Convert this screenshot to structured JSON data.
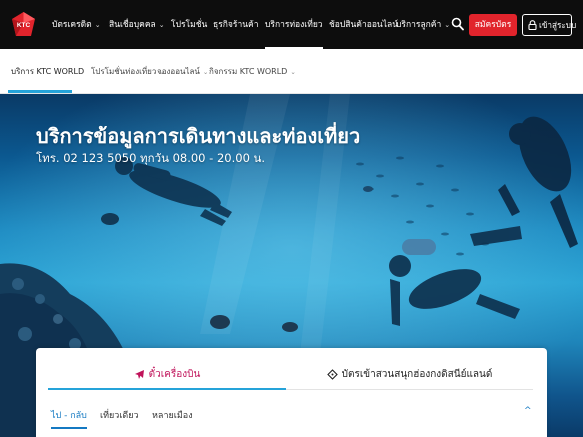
{
  "header": {
    "logo_text": "KTC",
    "nav": [
      {
        "label": "บัตรเครดิต",
        "has_dropdown": true
      },
      {
        "label": "สินเชื่อบุคคล",
        "has_dropdown": true
      },
      {
        "label": "โปรโมชั่น",
        "has_dropdown": false
      },
      {
        "label": "ธุรกิจร้านค้า",
        "has_dropdown": false
      },
      {
        "label": "บริการท่องเที่ยว",
        "has_dropdown": false,
        "active": true
      },
      {
        "label": "ช้อปสินค้าออนไลน์",
        "has_dropdown": false
      },
      {
        "label": "บริการลูกค้า",
        "has_dropdown": true
      }
    ],
    "apply_label": "สมัครบัตร",
    "login_label": "เข้าสู่ระบบ",
    "icons": [
      "search-icon",
      "lock-icon"
    ],
    "colors": {
      "bar": "#0d0d0d",
      "apply": "#e1242c"
    }
  },
  "subnav": {
    "items": [
      {
        "label": "บริการ KTC WORLD",
        "has_dropdown": false,
        "active": true
      },
      {
        "label": "โปรโมชั่นท่องเที่ยว",
        "has_dropdown": true
      },
      {
        "label": "จองออนไลน์",
        "has_dropdown": true
      },
      {
        "label": "กิจกรรม KTC WORLD",
        "has_dropdown": true
      }
    ],
    "accent": "#25a3d9"
  },
  "hero": {
    "title": "บริการข้อมูลการเดินทางและท่องเที่ยว",
    "subtitle": "โทร. 02 123 5050 ทุกวัน 08.00 - 20.00 น."
  },
  "booking": {
    "tabs": [
      {
        "label": "ตั๋วเครื่องบิน",
        "icon": "plane-icon",
        "active": true
      },
      {
        "label": "บัตรเข้าสวนสนุกฮ่องกงดิสนีย์แลนด์",
        "icon": "ticket-icon",
        "active": false
      }
    ],
    "trip_types": [
      {
        "label": "ไป - กลับ",
        "active": true
      },
      {
        "label": "เที่ยวเดียว",
        "active": false
      },
      {
        "label": "หลายเมือง",
        "active": false
      }
    ],
    "collapse_symbol": "^",
    "active_color": "#c0135a"
  }
}
